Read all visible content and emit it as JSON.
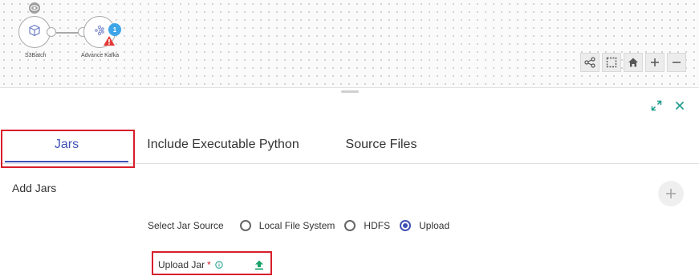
{
  "canvas": {
    "nodes": [
      {
        "label": "S3Batch",
        "icon": "cube-icon"
      },
      {
        "label": "Advance Kafka",
        "icon": "kafka-icon",
        "badge_count": "1",
        "has_warning": true
      }
    ],
    "toolbar": [
      "share-graph-icon",
      "select-area-icon",
      "home-icon",
      "zoom-in-icon",
      "zoom-out-icon"
    ]
  },
  "panel": {
    "tabs": [
      {
        "label": "Jars",
        "active": true
      },
      {
        "label": "Include Executable Python",
        "active": false
      },
      {
        "label": "Source Files",
        "active": false
      }
    ],
    "section_title": "Add Jars",
    "jar_source": {
      "label": "Select Jar Source",
      "options": [
        {
          "label": "Local File System",
          "checked": false
        },
        {
          "label": "HDFS",
          "checked": false
        },
        {
          "label": "Upload",
          "checked": true
        }
      ]
    },
    "upload": {
      "label": "Upload Jar",
      "required_mark": "*"
    }
  },
  "colors": {
    "accent": "#3f51b5",
    "highlight": "#d81e2b",
    "badge": "#3ea6e8",
    "upload_icon": "#1aa36b",
    "expand_icon": "#1a9b8a"
  }
}
